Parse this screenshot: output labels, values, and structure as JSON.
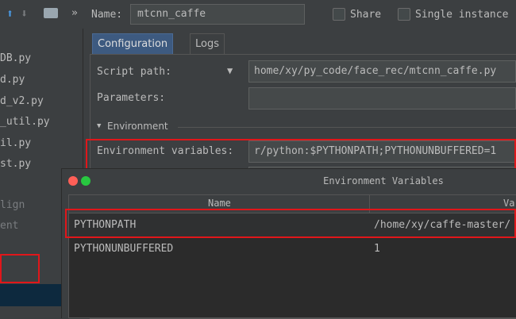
{
  "toolbar": {
    "name_label": "Name:",
    "name_value": "mtcnn_caffe",
    "share_label": "Share",
    "single_instance_label": "Single instance"
  },
  "project_files": [
    "DB.py",
    "d.py",
    "d_v2.py",
    "_util.py",
    "il.py",
    "st.py",
    "lign",
    "ent"
  ],
  "tabs": {
    "configuration": "Configuration",
    "logs": "Logs"
  },
  "config": {
    "script_path_label": "Script path:",
    "script_path_value": "home/xy/py_code/face_rec/mtcnn_caffe.py",
    "parameters_label": "Parameters:",
    "parameters_value": "",
    "environment_section": "Environment",
    "env_vars_label": "Environment variables:",
    "env_vars_value": "r/python:$PYTHONPATH;PYTHONUNBUFFERED=1"
  },
  "dialog": {
    "title": "Environment Variables",
    "columns": [
      "Name",
      "Va"
    ],
    "rows": [
      {
        "name": "PYTHONPATH",
        "value": "/home/xy/caffe-master/"
      },
      {
        "name": "PYTHONUNBUFFERED",
        "value": "1"
      }
    ]
  },
  "colors": {
    "background": "#3c3f41",
    "highlight_red": "#e0161a",
    "close_button": "#ff5f57",
    "maximize_button": "#28c840"
  }
}
